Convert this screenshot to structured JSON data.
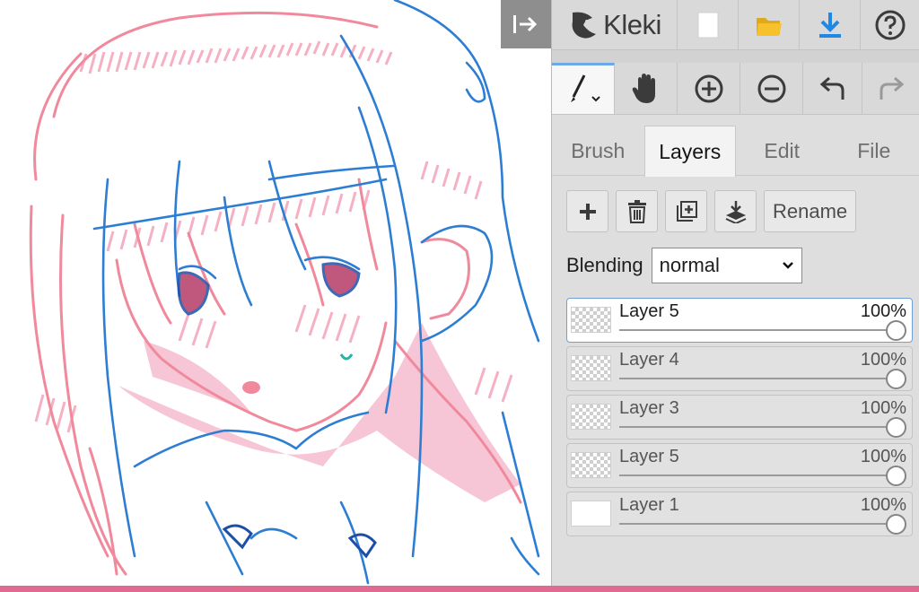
{
  "app": {
    "name": "Kleki"
  },
  "tabs": [
    {
      "label": "Brush",
      "active": false
    },
    {
      "label": "Layers",
      "active": true
    },
    {
      "label": "Edit",
      "active": false
    },
    {
      "label": "File",
      "active": false
    }
  ],
  "layer_panel": {
    "rename_label": "Rename",
    "blending_label": "Blending",
    "blending_value": "normal",
    "layers": [
      {
        "name": "Layer 5",
        "opacity": "100%",
        "selected": true
      },
      {
        "name": "Layer 4",
        "opacity": "100%",
        "selected": false
      },
      {
        "name": "Layer 3",
        "opacity": "100%",
        "selected": false
      },
      {
        "name": "Layer 5",
        "opacity": "100%",
        "selected": false
      },
      {
        "name": "Layer 1",
        "opacity": "100%",
        "selected": false
      }
    ]
  },
  "icons": {
    "collapse": "collapse-panel-icon",
    "logo": "kleki-logo-icon",
    "new": "new-file-icon",
    "open": "open-folder-icon",
    "save": "download-icon",
    "help": "help-icon",
    "brush": "brush-icon",
    "hand": "hand-icon",
    "zoom_in": "zoom-in-icon",
    "zoom_out": "zoom-out-icon",
    "undo": "undo-icon",
    "redo": "redo-icon",
    "add_layer": "plus-icon",
    "delete_layer": "trash-icon",
    "duplicate_layer": "duplicate-icon",
    "merge_down": "merge-down-icon"
  },
  "colors": {
    "accent": "#1e88e5",
    "folder": "#f6c12b",
    "canvas_border": "#e06a92",
    "stroke_red": "#f0899c",
    "stroke_blue": "#2d7ed3",
    "fill_pink": "#f7c6d6"
  }
}
